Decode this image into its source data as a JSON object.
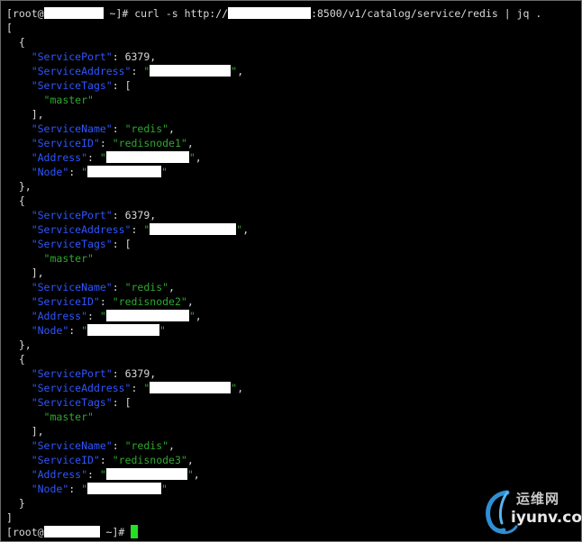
{
  "prompt_user": "root@",
  "prompt_dir": "~",
  "command": {
    "cmd": "curl -s http://",
    "port_path": ":8500/v1/catalog/service/redis | jq ."
  },
  "json": {
    "open_array": "[",
    "close_array": "]",
    "open_obj": "{",
    "close_obj_comma": "},",
    "close_obj": "}",
    "keys": {
      "port": "\"ServicePort\"",
      "address": "\"ServiceAddress\"",
      "tags": "\"ServiceTags\"",
      "name": "\"ServiceName\"",
      "id": "\"ServiceID\"",
      "addr": "\"Address\"",
      "node": "\"Node\""
    },
    "port_value": "6379",
    "tag_value": "\"master\"",
    "name_value": "\"redis\"",
    "entries": [
      {
        "id_value": "\"redisnode1\""
      },
      {
        "id_value": "\"redisnode2\""
      },
      {
        "id_value": "\"redisnode3\""
      }
    ]
  },
  "watermark": {
    "cn": "运维网",
    "en": "iyunv.com"
  },
  "colors": {
    "background": "#000000",
    "key": "#2f56ff",
    "string": "#2fa82f",
    "text": "#d8d8d8",
    "cursor": "#25e025"
  }
}
